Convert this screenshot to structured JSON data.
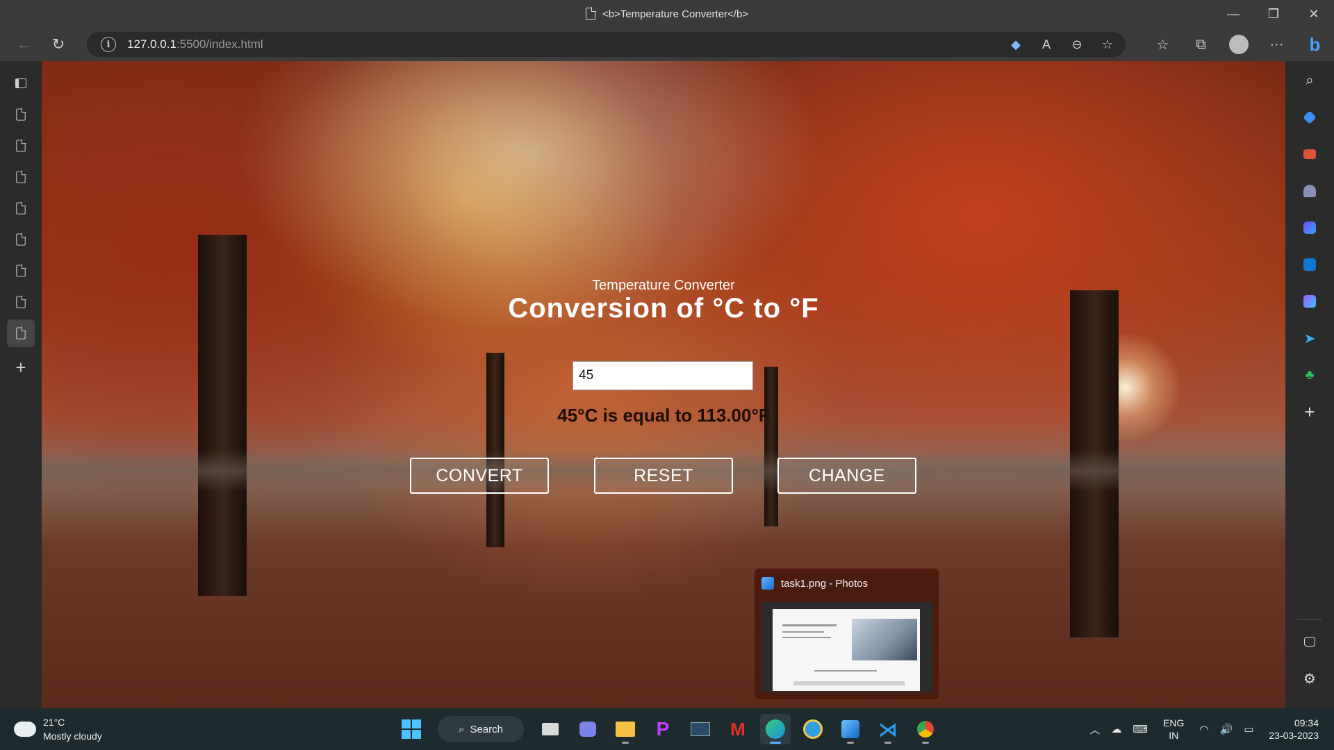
{
  "window": {
    "title": "<b>Temperature Converter</b>",
    "minimize_glyph": "—",
    "restore_glyph": "❐",
    "close_glyph": "✕"
  },
  "toolbar": {
    "url_host": "127.0.0.1",
    "url_path": ":5500/index.html",
    "back_glyph": "←",
    "refresh_glyph": "↻",
    "info_glyph": "i",
    "more_glyph": "···"
  },
  "icons": {
    "omnibox": [
      "shopping-tag-icon",
      "read-aloud-icon",
      "zoom-icon",
      "add-favorite-icon"
    ],
    "toolbar": [
      "favorites-icon",
      "collections-icon",
      "profile-icon",
      "more-icon",
      "bing-icon"
    ],
    "sidebar": [
      "search-icon",
      "shopping-icon",
      "tools-icon",
      "games-icon",
      "microsoft-365-icon",
      "outlook-icon",
      "designer-icon",
      "telegram-icon",
      "tree-icon",
      "add-icon"
    ],
    "sidebar_bottom": [
      "split-screen-icon",
      "settings-icon"
    ]
  },
  "page": {
    "subtitle": "Temperature Converter",
    "title": "Conversion of °C to °F",
    "input_value": "45",
    "result": "45°C is equal to 113.00°F",
    "buttons": {
      "convert": "CONVERT",
      "reset": "RESET",
      "change": "CHANGE"
    }
  },
  "thumbnail": {
    "title": "task1.png - Photos"
  },
  "taskbar": {
    "weather_temp": "21°C",
    "weather_desc": "Mostly cloudy",
    "search_label": "Search",
    "lang_line1": "ENG",
    "lang_line2": "IN",
    "time": "09:34",
    "date": "23-03-2023"
  },
  "colors": {
    "accent": "#4cc2ff",
    "titlebar": "#3b3b3b",
    "taskbar": "#1d2a2e"
  }
}
